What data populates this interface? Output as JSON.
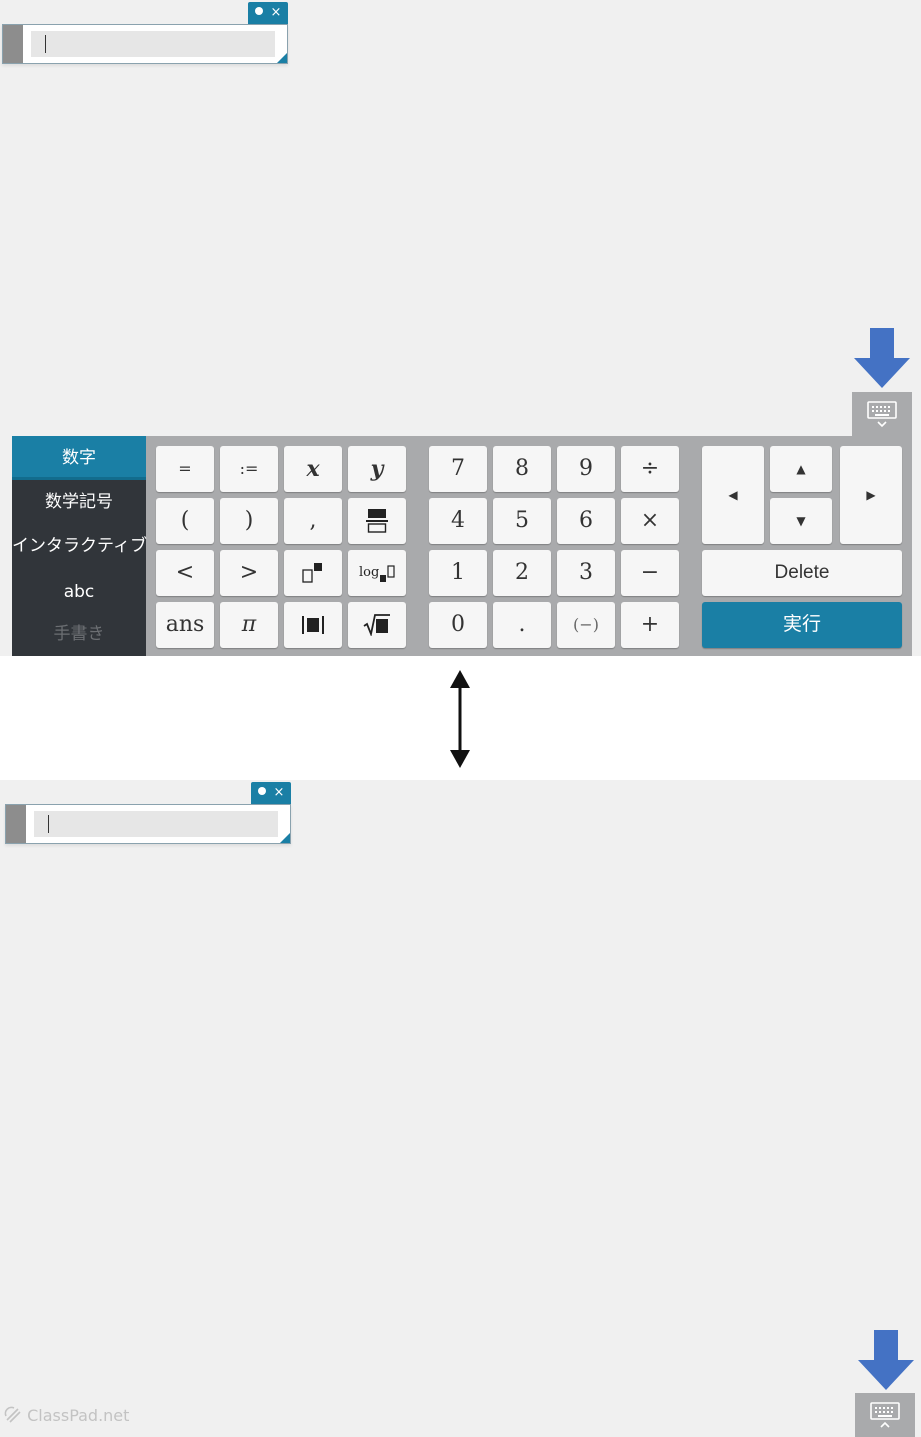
{
  "widget_top": {
    "edit_mark": "●",
    "close_mark": "×"
  },
  "widget_bottom": {
    "edit_mark": "●",
    "close_mark": "×"
  },
  "keyboard": {
    "categories": [
      "数字",
      "数学記号",
      "インタラクティブ",
      "abc",
      "手書き"
    ],
    "active_category": "数字",
    "symbol_keys": [
      "=",
      ":=",
      "x",
      "y",
      "(",
      ")",
      ",",
      "▭/▭",
      "<",
      ">",
      "▯■",
      "log■▯",
      "ans",
      "π",
      "|■|",
      "√■"
    ],
    "number_keys": [
      "7",
      "8",
      "9",
      "÷",
      "4",
      "5",
      "6",
      "×",
      "1",
      "2",
      "3",
      "−",
      "0",
      ".",
      "(−)",
      "+"
    ],
    "nav": {
      "left": "◀",
      "up": "▲",
      "down": "▼",
      "right": "▶"
    },
    "delete_label": "Delete",
    "execute_label": "実行"
  },
  "footer": {
    "brand": "ClassPad.net"
  },
  "colors": {
    "accent": "#1a7fa5",
    "arrow": "#4472c4",
    "sidebar": "#31353a",
    "panel": "#a9aaac"
  }
}
